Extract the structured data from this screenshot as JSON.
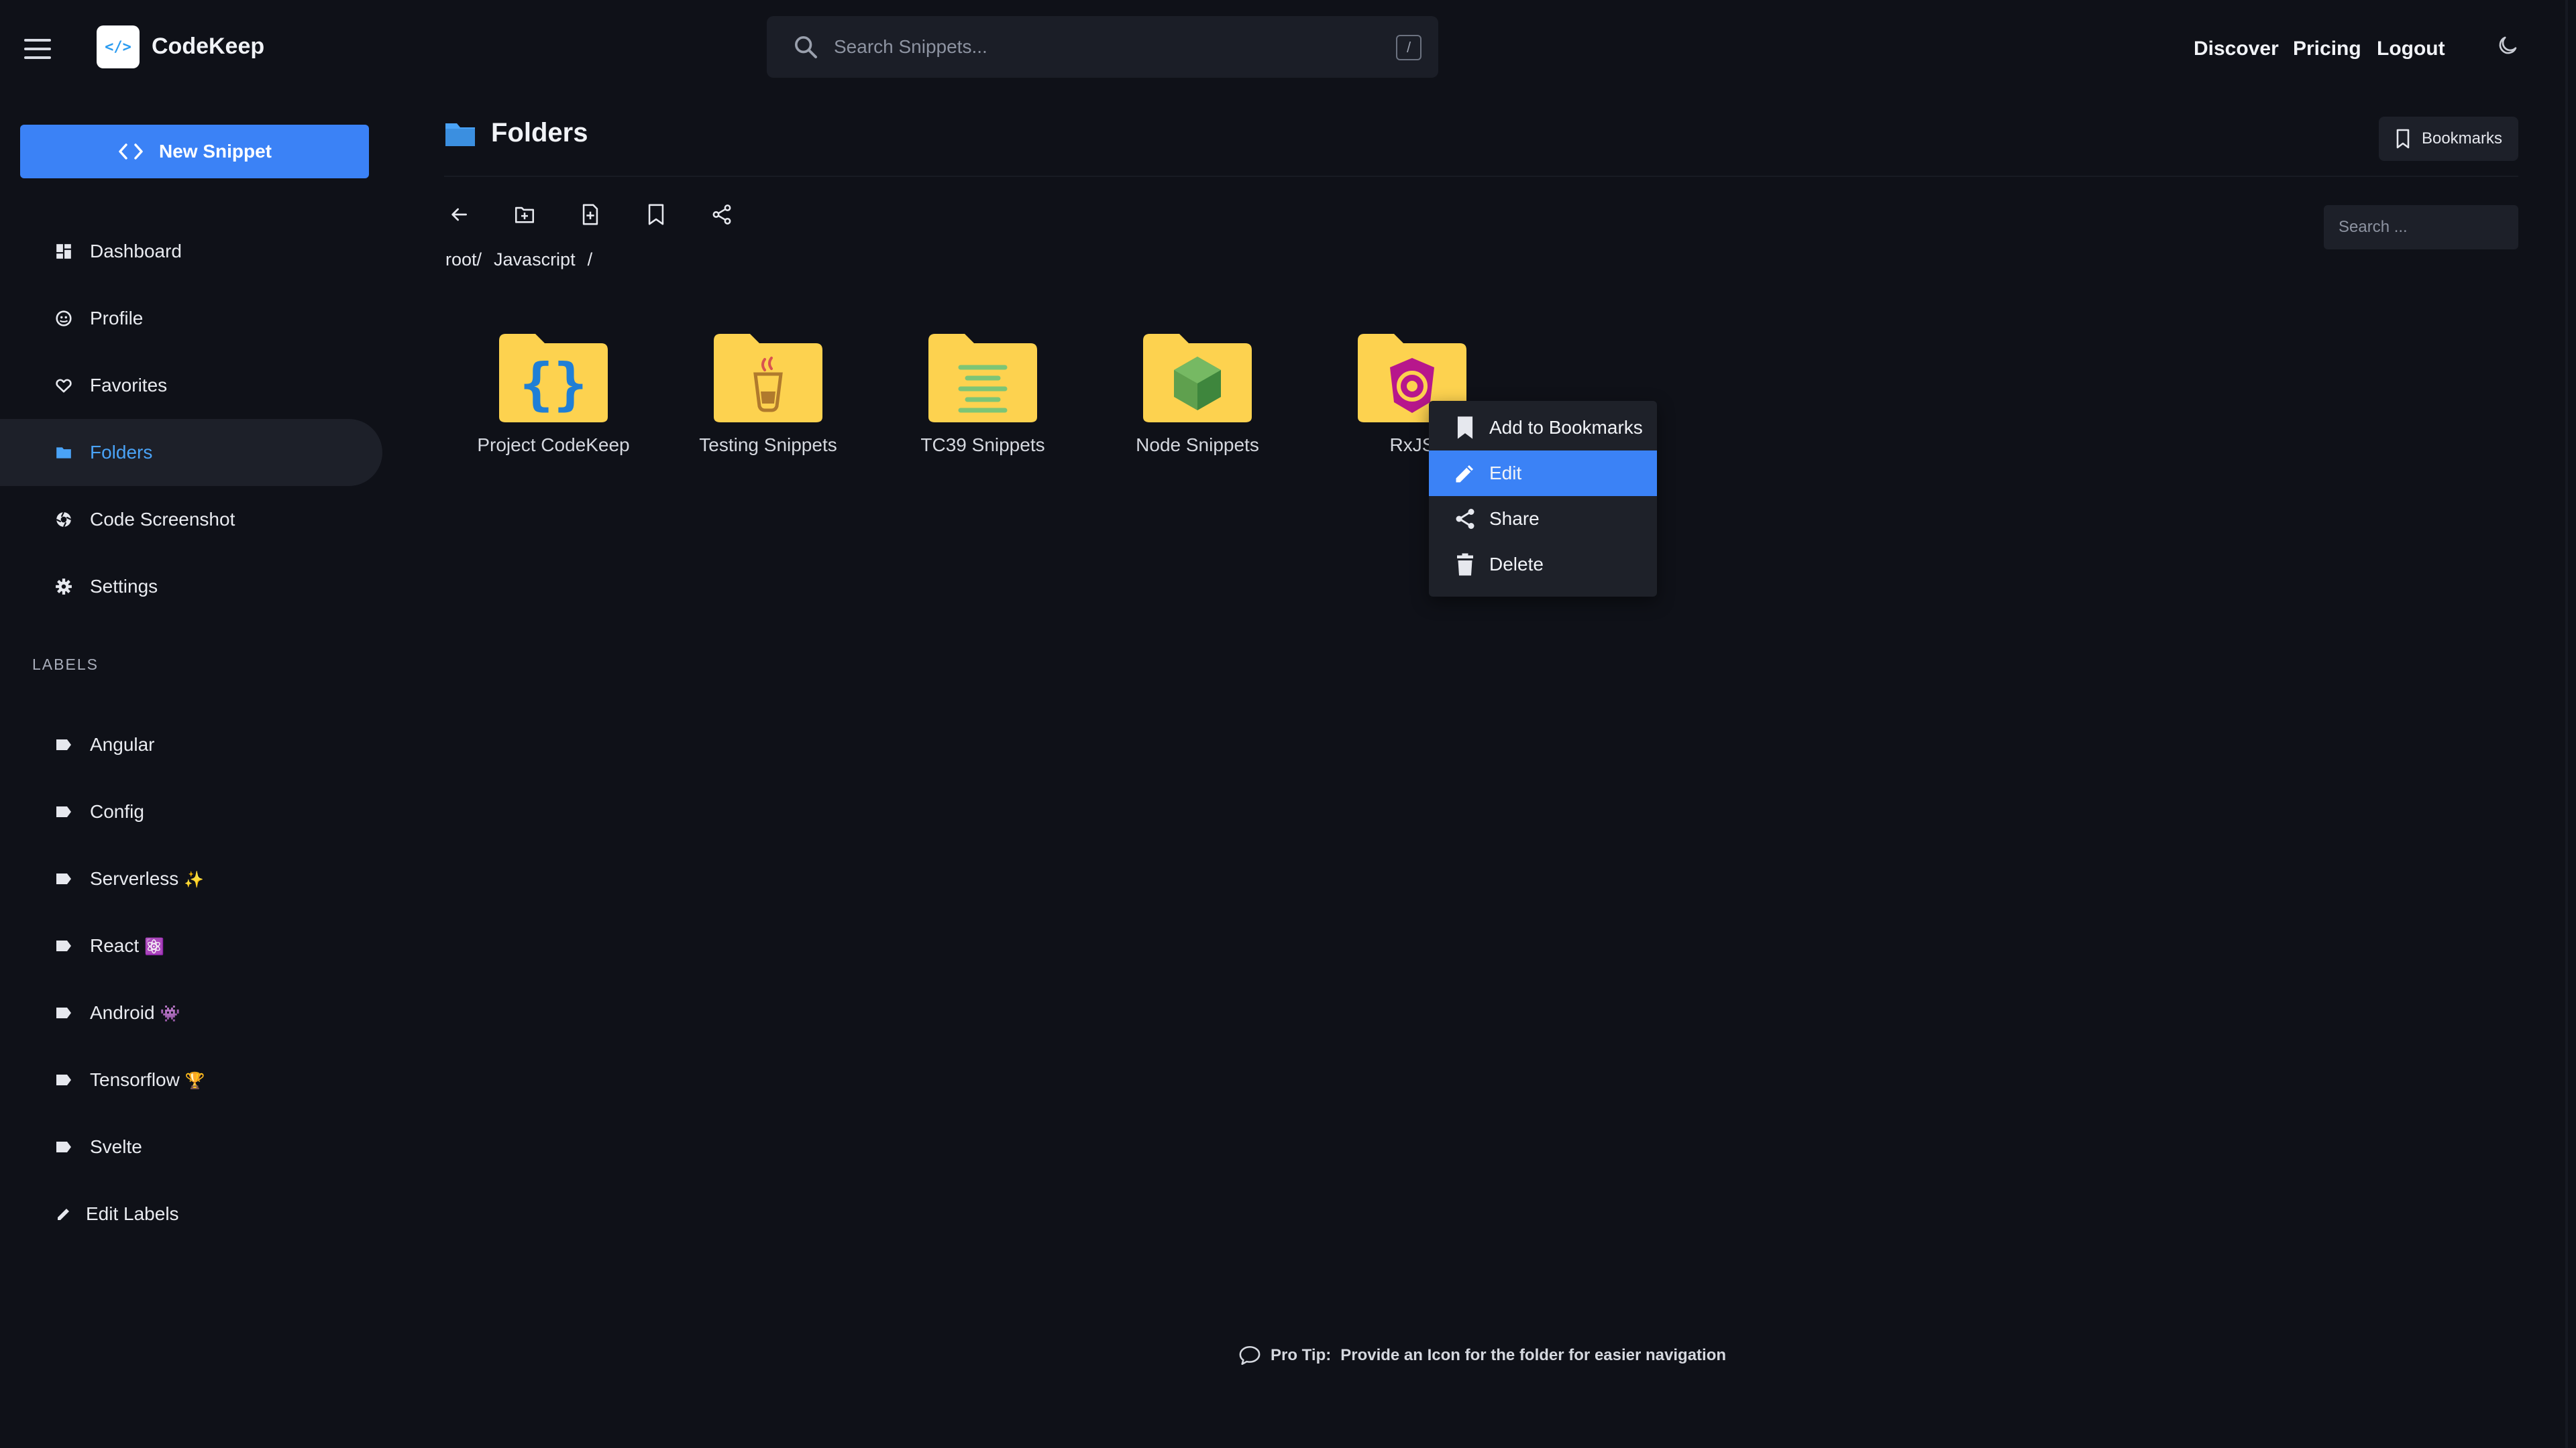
{
  "app": {
    "brand": "CodeKeep",
    "logo_text": "</>"
  },
  "topbar": {
    "search_placeholder": "Search Snippets...",
    "search_shortcut": "/",
    "links": [
      "Discover",
      "Pricing",
      "Logout"
    ]
  },
  "sidebar": {
    "new_snippet_label": "New Snippet",
    "nav": [
      {
        "label": "Dashboard",
        "icon": "dashboard-icon"
      },
      {
        "label": "Profile",
        "icon": "profile-icon"
      },
      {
        "label": "Favorites",
        "icon": "heart-icon"
      },
      {
        "label": "Folders",
        "icon": "folder-icon",
        "active": true
      },
      {
        "label": "Code Screenshot",
        "icon": "camera-icon"
      },
      {
        "label": "Settings",
        "icon": "gear-icon"
      }
    ],
    "labels_header": "LABELS",
    "labels": [
      {
        "label": "Angular",
        "emoji": ""
      },
      {
        "label": "Config",
        "emoji": ""
      },
      {
        "label": "Serverless",
        "emoji": "✨"
      },
      {
        "label": "React",
        "emoji": "⚛️"
      },
      {
        "label": "Android",
        "emoji": "👾"
      },
      {
        "label": "Tensorflow",
        "emoji": "🏆"
      },
      {
        "label": "Svelte",
        "emoji": ""
      }
    ],
    "edit_labels": "Edit Labels"
  },
  "main": {
    "title": "Folders",
    "bookmarks_label": "Bookmarks",
    "folder_search_placeholder": "Search ...",
    "breadcrumb": [
      "root/",
      "Javascript",
      "/"
    ],
    "folders": [
      {
        "name": "Project CodeKeep",
        "icon": "braces-icon"
      },
      {
        "name": "Testing Snippets",
        "icon": "coffee-cup-icon"
      },
      {
        "name": "TC39 Snippets",
        "icon": "lines-icon"
      },
      {
        "name": "Node Snippets",
        "icon": "nodejs-hexagon-icon"
      },
      {
        "name": "RxJS",
        "icon": "rxjs-icon"
      }
    ]
  },
  "context_menu": {
    "items": [
      {
        "label": "Add to Bookmarks",
        "icon": "bookmark-icon"
      },
      {
        "label": "Edit",
        "icon": "pencil-icon",
        "highlighted": true
      },
      {
        "label": "Share",
        "icon": "share-icon"
      },
      {
        "label": "Delete",
        "icon": "trash-icon"
      }
    ]
  },
  "footer": {
    "protip_prefix": "Pro Tip:",
    "protip_text": "Provide an Icon for the folder for easier navigation"
  },
  "colors": {
    "background": "#0f1118",
    "accent": "#3b82f6",
    "active_text": "#4aa3f7",
    "folder": "#fdd24f"
  }
}
